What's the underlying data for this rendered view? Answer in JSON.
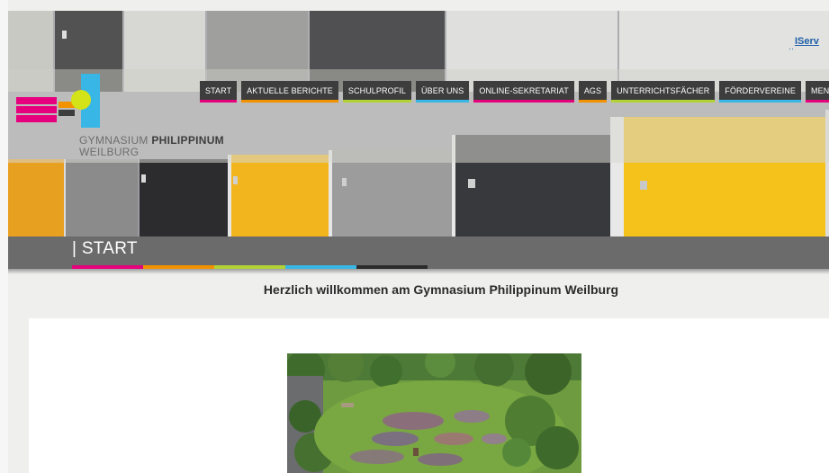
{
  "header": {
    "school_name_part1": "GYMNASIUM ",
    "school_name_part2": "PHILIPPINUM",
    "school_city": "WEILBURG",
    "iserv_label": "IServ"
  },
  "nav": {
    "items": [
      {
        "label": "START",
        "color": "#e6007e"
      },
      {
        "label": "AKTUELLE BERICHTE",
        "color": "#f39200"
      },
      {
        "label": "SCHULPROFIL",
        "color": "#b2d235"
      },
      {
        "label": "ÜBER UNS",
        "color": "#38b6e6"
      },
      {
        "label": "ONLINE-SEKRETARIAT",
        "color": "#e6007e"
      },
      {
        "label": "AGS",
        "color": "#f39200"
      },
      {
        "label": "UNTERRICHTSFÄCHER",
        "color": "#b2d235"
      },
      {
        "label": "FÖRDERVEREINE",
        "color": "#38b6e6"
      },
      {
        "label": "MENS",
        "color": "#e6007e"
      }
    ]
  },
  "page": {
    "title": "| START",
    "welcome": "Herzlich willkommen am Gymnasium Philippinum Weilburg"
  },
  "colors": {
    "magenta": "#e6007e",
    "orange": "#f39200",
    "lime": "#b2d235",
    "cyan": "#38b6e6",
    "dark": "#2b2b2b"
  }
}
